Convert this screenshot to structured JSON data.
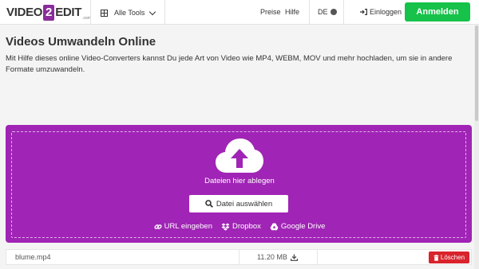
{
  "header": {
    "logo": {
      "part1": "VIDEO",
      "badge": "2",
      "part2": "EDIT",
      "tm": ".com"
    },
    "tools_label": "Alle Tools",
    "nav": {
      "prices": "Preise",
      "help": "Hilfe"
    },
    "language": "DE",
    "login_label": "Einloggen",
    "signup_label": "Anmelden"
  },
  "main": {
    "title": "Videos Umwandeln Online",
    "description": "Mit Hilfe dieses online Video-Converters kannst Du jede Art von Video wie MP4, WEBM, MOV und mehr hochladen, um sie in andere Formate umzuwandeln."
  },
  "dropzone": {
    "drop_text": "Dateien hier ablegen",
    "choose_label": "Datei auswählen",
    "sources": [
      {
        "icon": "link-icon",
        "label": "URL eingeben"
      },
      {
        "icon": "dropbox-icon",
        "label": "Dropbox"
      },
      {
        "icon": "google-drive-icon",
        "label": "Google Drive"
      }
    ]
  },
  "file": {
    "name": "blume.mp4",
    "size": "11.20 MB",
    "delete_label": "Löschen"
  },
  "colors": {
    "brand_purple": "#a024b5",
    "signup_green": "#16c24a",
    "delete_red": "#d9232d"
  }
}
